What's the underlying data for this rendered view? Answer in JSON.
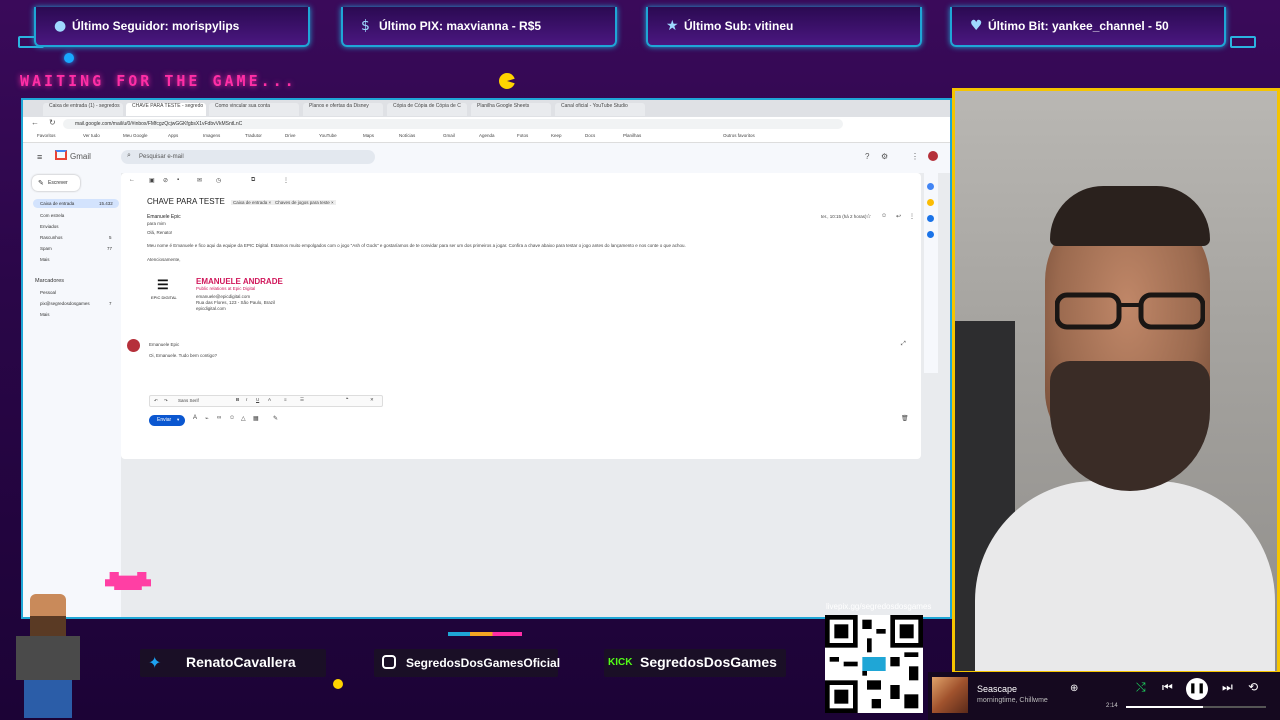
{
  "alerts": [
    {
      "icon": "person-icon",
      "text": "Último Seguidor: morispylips"
    },
    {
      "icon": "dollar-icon",
      "text": "Último PIX: maxvianna - R$5"
    },
    {
      "icon": "star-icon",
      "text": "Último Sub: vitineu"
    },
    {
      "icon": "diamond-icon",
      "text": "Último Bit: yankee_channel - 50"
    }
  ],
  "waiting_text": "WAITING FOR THE GAME...",
  "browser": {
    "tabs": [
      "Caixa de entrada (1) - segredos",
      "CHAVE PARA TESTE - segredo",
      "Como vincular sua conta",
      "Planos e ofertas da Disney",
      "Cópia de Cópia de Cópia de C",
      "Planilha Google Sheets",
      "Canal oficial - YouTube Studio"
    ],
    "url": "mail.google.com/mail/u/0/#inbox/FMfcgzQcjwGGKfgbsX1vFdbvVkMSntLnC",
    "bookmarks": [
      "Favoritos",
      "Ver tudo",
      "Meu Google",
      "Apps",
      "Imagens",
      "Tradutor",
      "Drive",
      "YouTube",
      "Maps",
      "Notícias",
      "Gmail",
      "Agenda",
      "Fotos",
      "Keep",
      "Docs",
      "Planilhas",
      "Outros favoritos"
    ]
  },
  "gmail": {
    "brand": "Gmail",
    "search_placeholder": "Pesquisar e-mail",
    "compose": "Escrever",
    "sidebar": [
      {
        "label": "Caixa de entrada",
        "count": "15.432"
      },
      {
        "label": "Com estrela",
        "count": ""
      },
      {
        "label": "Enviados",
        "count": ""
      },
      {
        "label": "Rascunhos",
        "count": "5"
      },
      {
        "label": "Spam",
        "count": "77"
      },
      {
        "label": "Mais",
        "count": ""
      }
    ],
    "labels_header": "Marcadores",
    "labels": [
      {
        "label": "Pessoal",
        "count": ""
      },
      {
        "label": "pix@segredosdosgames",
        "count": "7"
      },
      {
        "label": "Mais",
        "count": ""
      }
    ],
    "subject": "CHAVE PARA TESTE",
    "subject_tags": [
      "Caixa de entrada ×",
      "Chaves de jogos para teste ×"
    ],
    "sender": "Emanuele Epic",
    "to": "para mim",
    "date": "ter., 10:15 (há 2 horas)",
    "greeting": "Olá, Renato!",
    "body": "Meu nome é Emanuele e fico aqui da equipe da EPIC Digital. Estamos muito empolgados com o jogo \"Ash of Gods\" e gostaríamos de te convidar para ser um dos primeiros a jogar. Confira a chave abaixo para testar o jogo antes do lançamento e nos conte o que achou.",
    "closing": "Atenciosamente,",
    "signature_name": "EMANUELE ANDRADE",
    "signature_role": "Public relations at Epic Digital",
    "signature_lines": [
      "emanuele@epicdigital.com",
      "Rua das Flores, 123 - São Paulo, Brazil",
      "epicdigital.com"
    ],
    "signature_logo": "EPIC DIGITAL",
    "reply_to": "Emanuele Epic",
    "reply_text": "Oi, Emanuele. Tudo bem contigo?",
    "send": "Enviar",
    "format_font": "Sans Serif"
  },
  "socials": [
    {
      "icon": "twitter-icon",
      "text": "RenatoCavallera"
    },
    {
      "icon": "instagram-icon",
      "text": "SegredosDosGamesOficial"
    },
    {
      "icon": "kick-icon",
      "label": "KICK",
      "text": "SegredosDosGames"
    }
  ],
  "qr_label": "livepix.gg/segredosdosgames",
  "player": {
    "title": "Seascape",
    "artist": "morningtime, Chillwme",
    "time": "2:14",
    "progress": 0.55
  },
  "colors": {
    "accent": "#1fa6d6",
    "frame": "#f5c400",
    "neon": "#ff2ea6",
    "gmail_blue": "#0b57d0"
  }
}
